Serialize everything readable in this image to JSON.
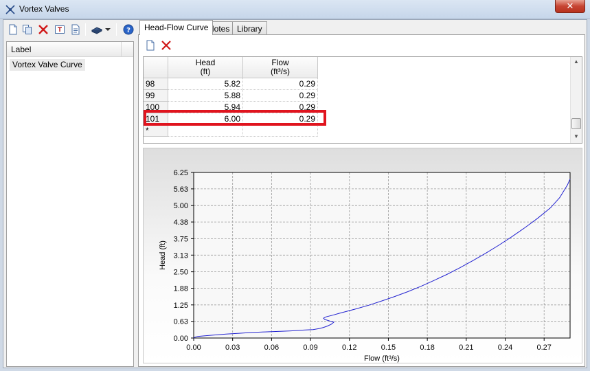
{
  "window": {
    "title": "Vortex Valves",
    "close_label": "✕"
  },
  "toolbar": {
    "icons": [
      "new-icon",
      "copy-icon",
      "delete-icon",
      "rename-icon",
      "report-icon",
      "library-icon",
      "dropdown-arrow-icon",
      "help-icon"
    ]
  },
  "label_list": {
    "header": "Label",
    "items": [
      {
        "label": "Vortex Valve Curve",
        "selected": true
      }
    ]
  },
  "tabs": [
    {
      "label": "Head-Flow Curve",
      "active": true
    },
    {
      "label": "Notes",
      "active": false
    },
    {
      "label": "Library",
      "active": false
    }
  ],
  "curve_toolbar": {
    "icons": [
      "new-row-icon",
      "delete-row-icon"
    ]
  },
  "grid": {
    "columns": [
      {
        "name": "Head",
        "unit": "(ft)"
      },
      {
        "name": "Flow",
        "unit": "(ft³/s)"
      }
    ],
    "rows": [
      {
        "index": "98",
        "head": "5.82",
        "flow": "0.29"
      },
      {
        "index": "99",
        "head": "5.88",
        "flow": "0.29"
      },
      {
        "index": "100",
        "head": "5.94",
        "flow": "0.29"
      },
      {
        "index": "101",
        "head": "6.00",
        "flow": "0.29"
      }
    ],
    "new_row_marker": "*",
    "highlighted_row": "101"
  },
  "colors": {
    "highlight": "#e0141e",
    "series": "#2020d0",
    "grid": "#9a9a9a"
  },
  "chart_data": {
    "type": "line",
    "xlabel": "Flow (ft³/s)",
    "ylabel": "Head (ft)",
    "xlim": [
      0,
      0.29
    ],
    "ylim": [
      0,
      6.25
    ],
    "x_ticks": [
      "0.00",
      "0.03",
      "0.06",
      "0.09",
      "0.12",
      "0.15",
      "0.18",
      "0.21",
      "0.24",
      "0.27"
    ],
    "y_ticks": [
      "0.00",
      "0.63",
      "1.25",
      "1.88",
      "2.50",
      "3.13",
      "3.75",
      "4.38",
      "5.00",
      "5.63",
      "6.25"
    ],
    "grid": true,
    "legend": "none",
    "series": [
      {
        "x": [
          0.0,
          0.001,
          0.003,
          0.008,
          0.015,
          0.025,
          0.035,
          0.045,
          0.055,
          0.065,
          0.075,
          0.085,
          0.092,
          0.097,
          0.1,
          0.103,
          0.106,
          0.108,
          0.105,
          0.101,
          0.1,
          0.102,
          0.107,
          0.112,
          0.118,
          0.125,
          0.135,
          0.145,
          0.155,
          0.165,
          0.175,
          0.185,
          0.195,
          0.205,
          0.215,
          0.225,
          0.235,
          0.245,
          0.255,
          0.265,
          0.275,
          0.282,
          0.288,
          0.29
        ],
        "y": [
          0.0,
          0.03,
          0.06,
          0.08,
          0.11,
          0.15,
          0.18,
          0.21,
          0.23,
          0.25,
          0.27,
          0.3,
          0.32,
          0.36,
          0.4,
          0.45,
          0.52,
          0.6,
          0.64,
          0.7,
          0.75,
          0.8,
          0.86,
          0.93,
          1.01,
          1.1,
          1.24,
          1.4,
          1.57,
          1.75,
          1.95,
          2.17,
          2.4,
          2.65,
          2.92,
          3.2,
          3.5,
          3.82,
          4.16,
          4.52,
          4.92,
          5.3,
          5.78,
          6.0
        ]
      }
    ]
  }
}
